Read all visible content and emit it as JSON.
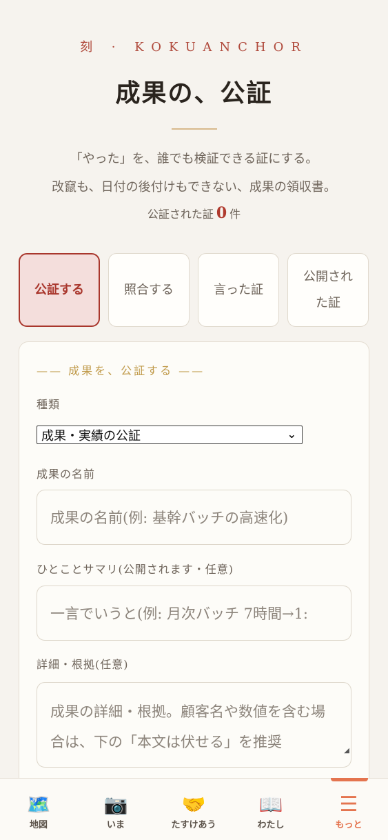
{
  "header": {
    "brand": "刻 · KOKUANCHOR",
    "title": "成果の、公証",
    "lead_line1": "「やった」を、誰でも検証できる証にする。",
    "lead_line2": "改竄も、日付の後付けもできない、成果の領収書。",
    "count_prefix": "公証された証",
    "count_value": "0",
    "count_suffix": "件"
  },
  "tabs": [
    {
      "label": "公証する",
      "active": true
    },
    {
      "label": "照合する",
      "active": false
    },
    {
      "label": "言った証",
      "active": false
    },
    {
      "label": "公開された証",
      "active": false
    }
  ],
  "form": {
    "section_title": "—— 成果を、公証する ——",
    "type_label": "種類",
    "type_value": "成果・実績の公証",
    "name_label": "成果の名前",
    "name_placeholder": "成果の名前(例: 基幹バッチの高速化)",
    "summary_label": "ひとことサマリ(公開されます・任意)",
    "summary_placeholder": "一言でいうと(例: 月次バッチ 7時間→1:",
    "detail_label": "詳細・根拠(任意)",
    "detail_placeholder": "成果の詳細・根拠。顧客名や数値を含む場合は、下の「本文は伏せる」を推奨"
  },
  "bottom_nav": [
    {
      "label": "地図",
      "icon": "world-map-icon",
      "glyph": "🗺️"
    },
    {
      "label": "いま",
      "icon": "camera-icon",
      "glyph": "📷"
    },
    {
      "label": "たすけあう",
      "icon": "handshake-icon",
      "glyph": "🤝"
    },
    {
      "label": "わたし",
      "icon": "book-icon",
      "glyph": "📖"
    },
    {
      "label": "もっと",
      "icon": "menu-icon",
      "glyph": "☰",
      "active": true
    }
  ],
  "colors": {
    "accent": "#a9372d",
    "gold": "#c09a4a",
    "nav_active": "#e4744f",
    "background": "#f6f3ee"
  }
}
